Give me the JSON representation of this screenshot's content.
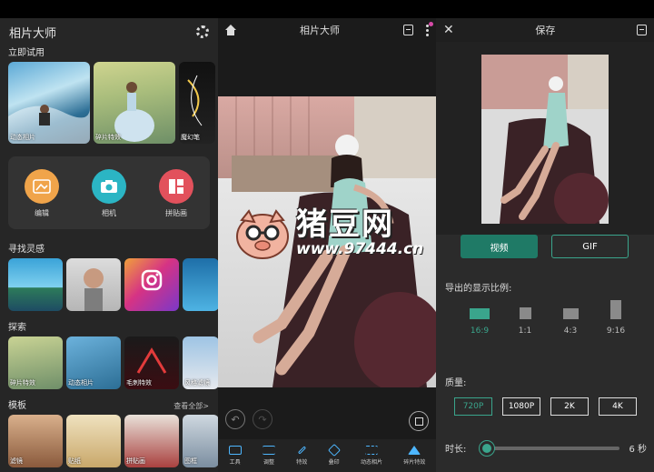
{
  "panel1": {
    "app_title": "相片大师",
    "sections": {
      "try_now": "立即试用",
      "inspiration": "寻找灵感",
      "explore": "探索",
      "templates": "模板",
      "see_all": "查看全部>"
    },
    "try_items": [
      "动态相片",
      "碎片特效",
      "魔幻笔"
    ],
    "tools": [
      {
        "label": "编辑",
        "color": "#f0a44a",
        "icon": "edit-icon"
      },
      {
        "label": "相机",
        "color": "#2bb5c4",
        "icon": "camera-icon"
      },
      {
        "label": "拼贴画",
        "color": "#e2515c",
        "icon": "collage-icon"
      }
    ],
    "explore_items": [
      "碎片特效",
      "动态相片",
      "毛刺特效",
      "风格滤镜"
    ],
    "template_items": [
      "滤镜",
      "贴纸",
      "拼贴画",
      "图框"
    ]
  },
  "panel2": {
    "title": "相片大师",
    "bottom_tools": [
      "工具",
      "调整",
      "特效",
      "叠印",
      "动态相片",
      "碎片特效"
    ]
  },
  "panel3": {
    "title": "保存",
    "formats": {
      "video": "视频",
      "gif": "GIF"
    },
    "ratio_label": "导出的显示比例:",
    "ratios": [
      "16:9",
      "1:1",
      "4:3",
      "9:16"
    ],
    "selected_ratio": "16:9",
    "quality_label": "质量:",
    "qualities": [
      "720P",
      "1080P",
      "2K",
      "4K"
    ],
    "selected_quality": "720P",
    "duration_label": "时长:",
    "duration_value": "6 秒",
    "duration_fraction": 0.0
  },
  "watermark": {
    "brand": "猪豆网",
    "url": "www.97444.cn"
  },
  "colors": {
    "accent": "#3aa58c",
    "accent_dark": "#1f7a66",
    "badge": "#d64aa8"
  }
}
